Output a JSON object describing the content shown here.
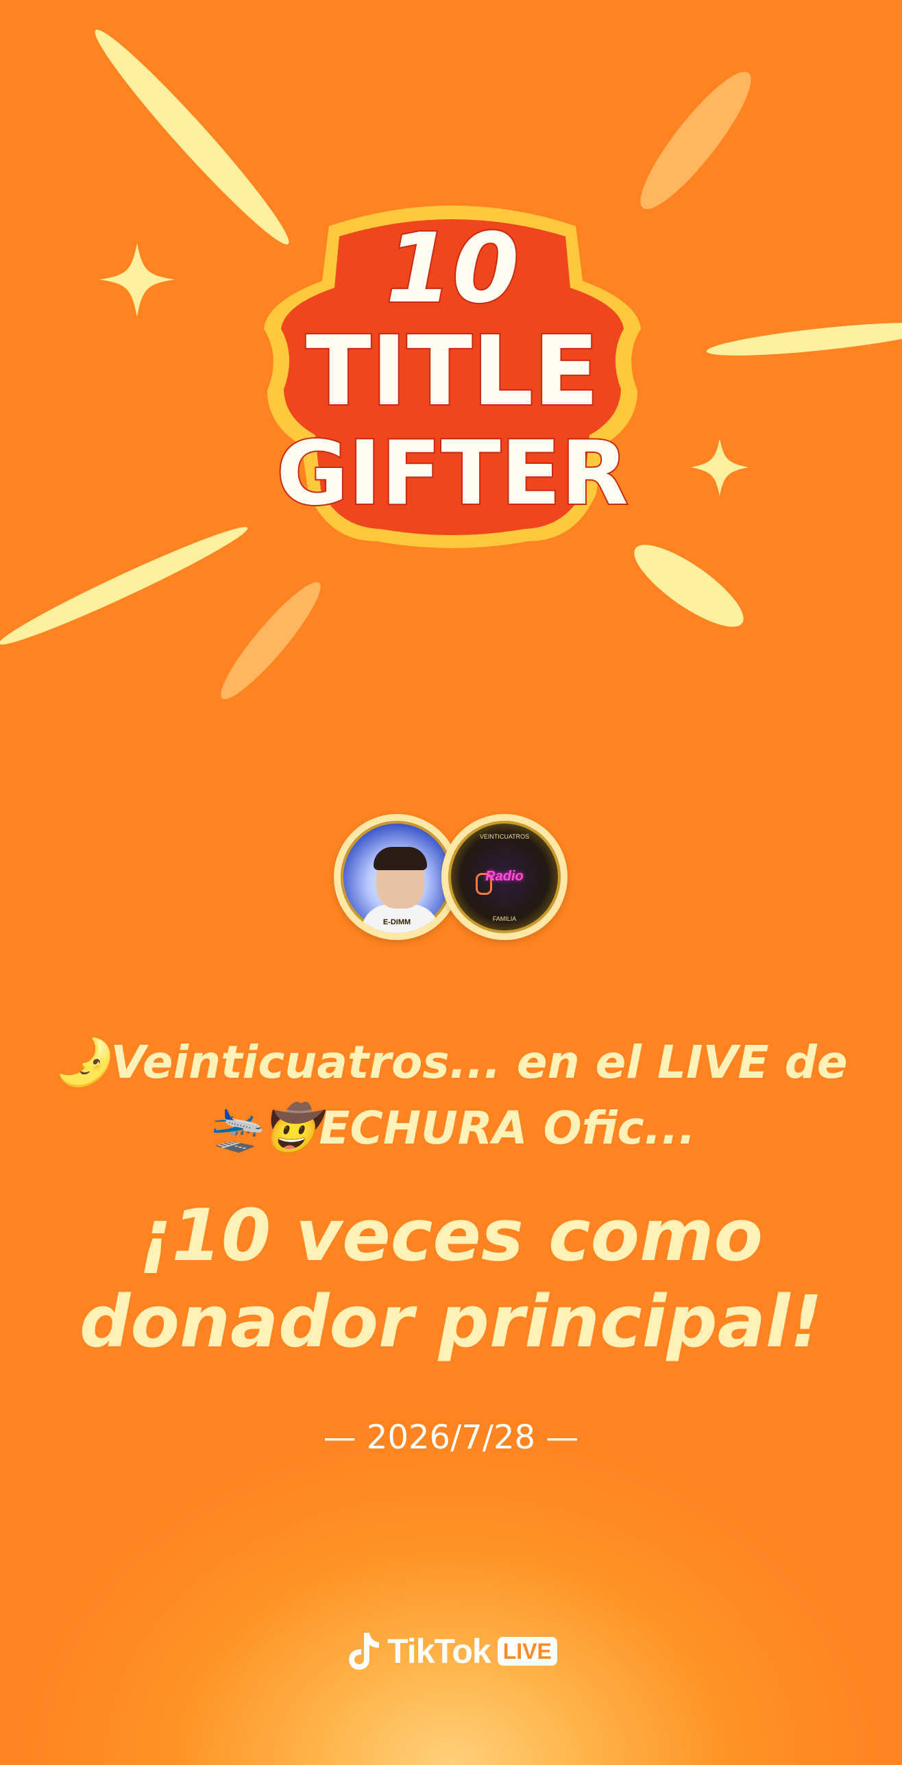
{
  "logo": {
    "number": "10",
    "line1": "TITLE",
    "line2": "GIFTER"
  },
  "avatars": {
    "left_caption": "E-DIMM",
    "right_top": "VEINTICUATROS",
    "right_center": "Radio",
    "right_bottom": "FAMILIA"
  },
  "message": {
    "line1": "🌛Veinticuatros... en el LIVE de",
    "line2": "🛬🤠ECHURA Ofic...",
    "headline_line1": "¡10 veces como",
    "headline_line2": "donador principal!",
    "date": "— 2026/7/28 —"
  },
  "brand": {
    "name": "TikTok",
    "badge": "LIVE",
    "icon": "tiktok-note-icon"
  },
  "colors": {
    "background": "#ff8421",
    "text_cream": "#fff1b8",
    "logo_red": "#f0461e",
    "logo_gold": "#ffc83d"
  }
}
